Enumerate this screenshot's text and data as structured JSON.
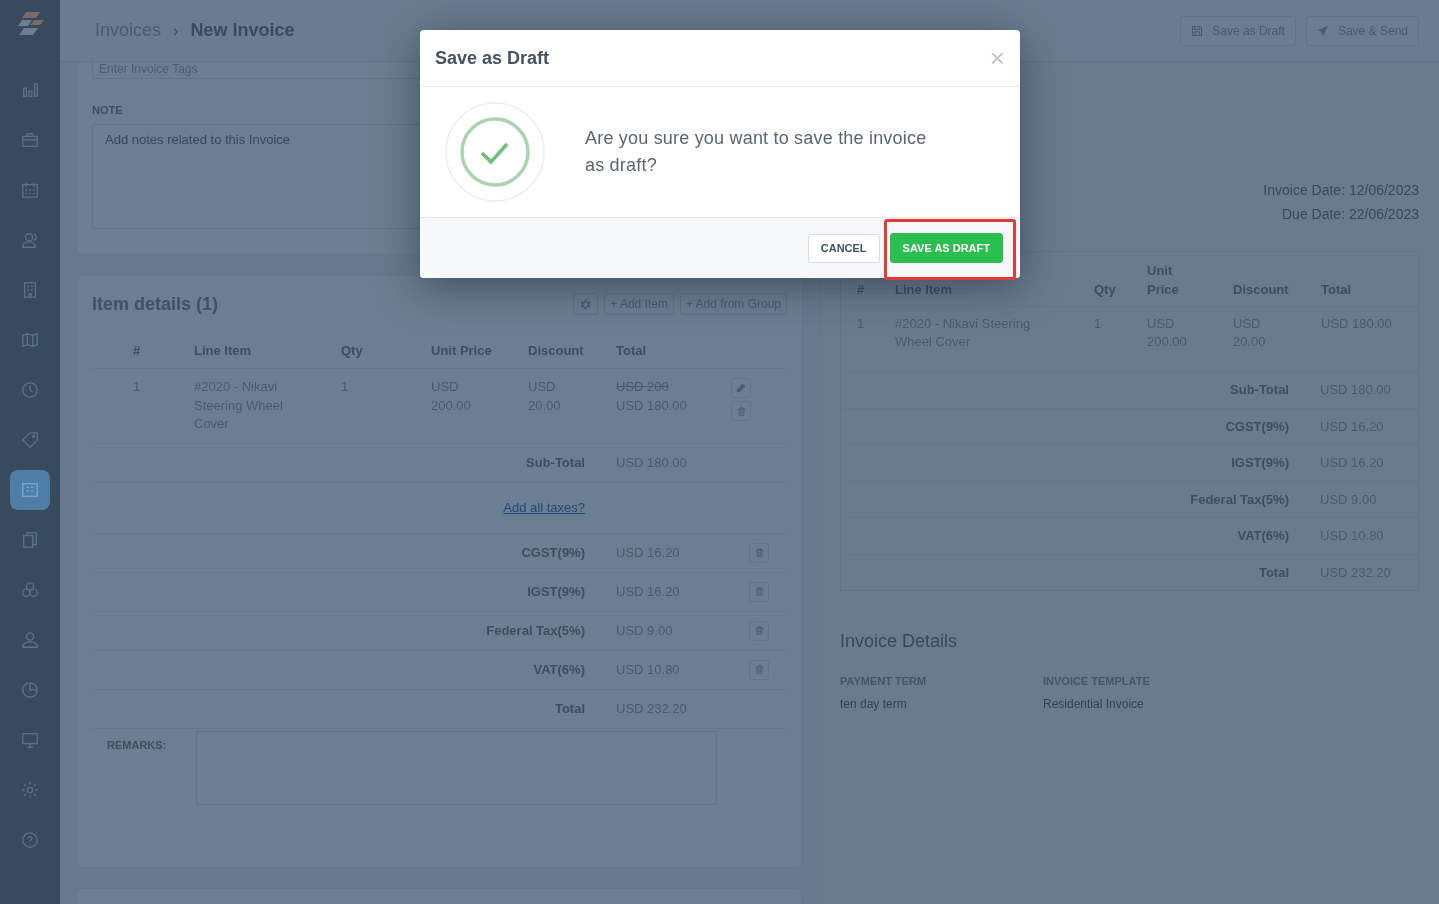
{
  "sidebar": {
    "items": [
      {
        "selected": false
      },
      {
        "selected": false
      },
      {
        "selected": false
      },
      {
        "selected": false
      },
      {
        "selected": false
      },
      {
        "selected": false
      },
      {
        "selected": false
      },
      {
        "selected": false
      },
      {
        "selected": true
      },
      {
        "selected": false
      },
      {
        "selected": false
      },
      {
        "selected": false
      },
      {
        "selected": false
      },
      {
        "selected": false
      },
      {
        "selected": false
      },
      {
        "selected": false
      }
    ]
  },
  "header": {
    "breadcrumb": [
      "Invoices",
      "New Invoice"
    ],
    "separator": "›",
    "actions": [
      {
        "label": "Save as Draft",
        "kind": "draft"
      },
      {
        "label": "Save & Send",
        "kind": "send"
      }
    ]
  },
  "notes": {
    "tags_placeholder": "Enter Invoice Tags",
    "label": "NOTE",
    "placeholder": "Add notes related to this Invoice"
  },
  "item_details": {
    "title": "Item details (1)",
    "toolbar": [
      "+ Add Item",
      "+ Add from Group"
    ],
    "columns": [
      "#",
      "Line Item",
      "Qty",
      "Unit Price",
      "Discount",
      "Total"
    ],
    "rows": [
      {
        "number": "1",
        "line_item": "#2020 - Nikavi Steering Wheel Cover",
        "qty": "1",
        "unit_price": "USD 200.00",
        "discount": "USD 20.00",
        "original_total": "USD 200",
        "total": "USD 180.00"
      }
    ],
    "subtotal": {
      "label": "Sub-Total",
      "value": "USD 180.00"
    },
    "add_taxes_link": "Add all taxes?",
    "taxes": [
      {
        "label": "CGST(9%)",
        "value": "USD 16.20"
      },
      {
        "label": "IGST(9%)",
        "value": "USD 16.20"
      },
      {
        "label": "Federal Tax(5%)",
        "value": "USD 9.00"
      },
      {
        "label": "VAT(6%)",
        "value": "USD 10.80"
      }
    ],
    "total": {
      "label": "Total",
      "value": "USD 232.20"
    },
    "remarks_label": "REMARKS:"
  },
  "preview": {
    "invoice_date": "Invoice Date: 12/06/2023",
    "due_date": "Due Date: 22/06/2023",
    "columns": [
      "#",
      "Line Item",
      "Qty",
      "Unit Price",
      "Discount",
      "Total"
    ],
    "rows": [
      {
        "number": "1",
        "line_item": "#2020 - Nikavi Steering Wheel Cover",
        "qty": "1",
        "unit_price": "USD 200.00",
        "discount": "USD 20.00",
        "total": "USD 180.00"
      }
    ],
    "summary": [
      {
        "label": "Sub-Total",
        "value": "USD 180.00"
      },
      {
        "label": "CGST(9%)",
        "value": "USD 16.20"
      },
      {
        "label": "IGST(9%)",
        "value": "USD 16.20"
      },
      {
        "label": "Federal Tax(5%)",
        "value": "USD 9.00"
      },
      {
        "label": "VAT(6%)",
        "value": "USD 10.80"
      },
      {
        "label": "Total",
        "value": "USD 232.20"
      }
    ]
  },
  "invoice_details": {
    "title": "Invoice Details",
    "fields": [
      {
        "label": "PAYMENT TERM",
        "value": "ten day term"
      },
      {
        "label": "INVOICE TEMPLATE",
        "value": "Residential Invoice"
      }
    ]
  },
  "dialog": {
    "title": "Save as Draft",
    "close": "×",
    "message": "Are you sure you want to save the invoice as draft?",
    "buttons": [
      {
        "label": "CANCEL",
        "kind": "secondary",
        "highlighted": false
      },
      {
        "label": "SAVE AS DRAFT",
        "kind": "primary",
        "highlighted": true
      }
    ]
  }
}
